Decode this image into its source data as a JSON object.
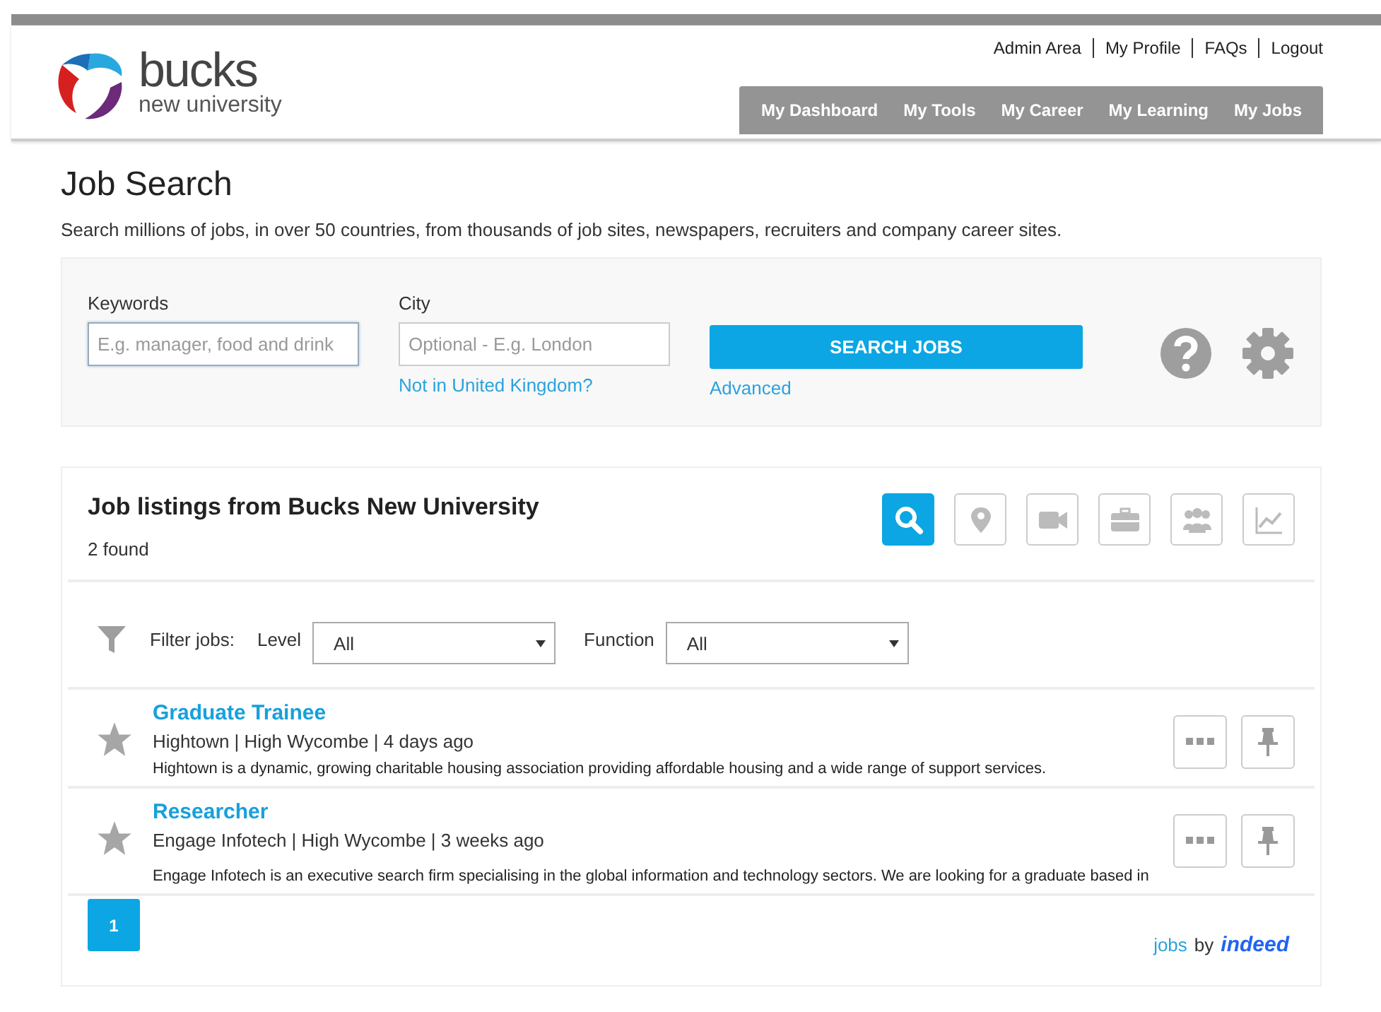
{
  "header": {
    "logo": {
      "name": "bucks",
      "subtitle": "new university"
    },
    "top_links": [
      "Admin Area",
      "My Profile",
      "FAQs",
      "Logout"
    ],
    "nav": [
      {
        "label": "My Dashboard",
        "selected": false
      },
      {
        "label": "My Tools",
        "selected": false
      },
      {
        "label": "My Career",
        "selected": false
      },
      {
        "label": "My Learning",
        "selected": false
      },
      {
        "label": "My Jobs",
        "selected": false
      }
    ]
  },
  "page": {
    "title": "Job Search",
    "intro": "Search millions of jobs, in over 50 countries, from thousands of job sites, newspapers, recruiters and company career sites."
  },
  "search": {
    "keywords": {
      "label": "Keywords",
      "placeholder": "E.g. manager, food and drink"
    },
    "city": {
      "label": "City",
      "placeholder": "Optional - E.g. London",
      "link": "Not in United Kingdom?"
    },
    "button": "SEARCH JOBS",
    "advanced": "Advanced"
  },
  "listings": {
    "title": "Job listings from Bucks New University",
    "count": "2 found",
    "views": [
      {
        "kind": "search",
        "selected": true
      },
      {
        "kind": "pin",
        "selected": false
      },
      {
        "kind": "video",
        "selected": false
      },
      {
        "kind": "briefcase",
        "selected": false
      },
      {
        "kind": "people",
        "selected": false
      },
      {
        "kind": "chart",
        "selected": false
      }
    ],
    "filter": {
      "label": "Filter jobs:",
      "level": {
        "label": "Level",
        "value": "All"
      },
      "function": {
        "label": "Function",
        "value": "All"
      }
    },
    "jobs": [
      {
        "title": "Graduate Trainee",
        "meta": "Hightown | High Wycombe | 4 days ago",
        "description": "Hightown is a dynamic, growing charitable housing association providing affordable housing and a wide range of support services.",
        "starred": false
      },
      {
        "title": "Researcher",
        "meta": "Engage Infotech | High Wycombe | 3 weeks ago",
        "description": "Engage Infotech is an executive search firm specialising in the global information and technology sectors. We are looking for a graduate based in",
        "starred": false
      }
    ],
    "pages": [
      {
        "label": "1",
        "selected": true
      }
    ],
    "credit": {
      "jobs": "jobs",
      "by": "by",
      "brand": "indeed"
    }
  }
}
